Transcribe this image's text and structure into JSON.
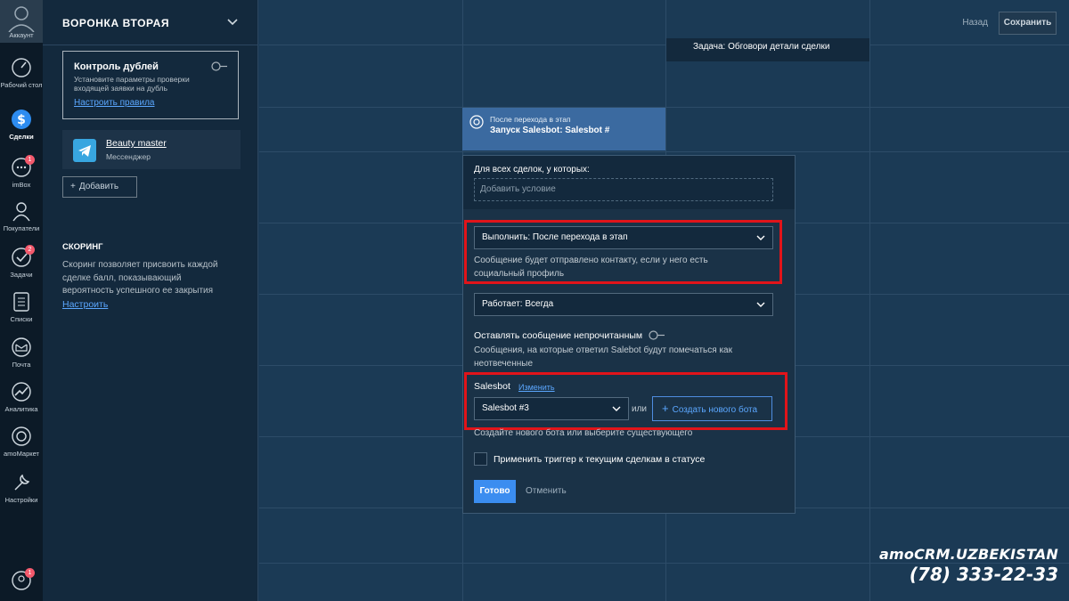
{
  "rail": {
    "account": "Аккаунт",
    "items": [
      {
        "label": "Рабочий стол",
        "icon": "speedometer-icon"
      },
      {
        "label": "Сделки",
        "icon": "deals-icon",
        "active": true
      },
      {
        "label": "imBox",
        "icon": "chat-icon",
        "badge": "1"
      },
      {
        "label": "Покупатели",
        "icon": "customers-icon"
      },
      {
        "label": "Задачи",
        "icon": "tasks-icon",
        "badge": "2"
      },
      {
        "label": "Списки",
        "icon": "lists-icon"
      },
      {
        "label": "Почта",
        "icon": "mail-icon"
      },
      {
        "label": "Аналитика",
        "icon": "analytics-icon"
      },
      {
        "label": "amoМаркет",
        "icon": "market-icon"
      },
      {
        "label": "Настройки",
        "icon": "settings-icon"
      }
    ],
    "bottom_badge": "1"
  },
  "sidebar": {
    "title": "ВОРОНКА ВТОРАЯ",
    "duplicates": {
      "title": "Контроль дублей",
      "desc": "Установите параметры проверки входящей заявки на дубль",
      "link": "Настроить правила"
    },
    "source": {
      "name": "Beauty master",
      "type": "Мессенджер"
    },
    "add_label": "Добавить",
    "scoring": {
      "title": "СКОРИНГ",
      "desc": "Скоринг позволяет присвоить каждой сделке балл, показывающий вероятность успешного ее закрытия",
      "link": "Настроить"
    }
  },
  "topbar": {
    "back": "Назад",
    "save": "Сохранить"
  },
  "task_card": {
    "text": "Задача: Обговори детали сделки"
  },
  "trigger": {
    "small": "После перехода в этап",
    "title": "Запуск Salesbot: Salesbot #"
  },
  "popup": {
    "cond_label": "Для всех сделок, у которых:",
    "cond_placeholder": "Добавить условие",
    "execute_value": "Выполнить: После перехода в этап",
    "execute_hint": "Сообщение будет отправлено контакту, если у него есть социальный профиль",
    "works_value": "Работает: Всегда",
    "unread_label": "Оставлять сообщение непрочитанным",
    "unread_hint": "Сообщения, на которые ответил Salebot будут помечаться как неотвеченные",
    "salesbot_label": "Salesbot",
    "change_link": "Изменить",
    "bot_value": "Salesbot #3",
    "or_text": "или",
    "create_bot": "Создать нового бота",
    "bot_hint": "Создайте нового бота или выберите существующего",
    "apply_label": "Применить триггер к текущим сделкам в статусе",
    "done": "Готово",
    "cancel": "Отменить"
  },
  "watermark": {
    "logo": "amoCRM.UZBEKISTAN",
    "phone": "(78) 333-22-33"
  },
  "colors": {
    "accent": "#3b8df0",
    "link": "#5ba7ff",
    "highlight": "#e1141a",
    "trigger_bg": "#3b6aa0"
  }
}
